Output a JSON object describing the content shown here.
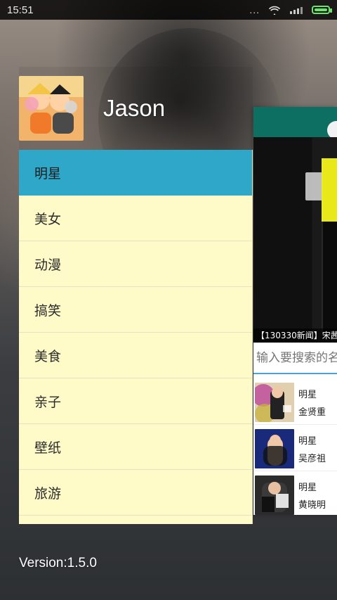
{
  "status_bar": {
    "time": "15:51",
    "dots": "...",
    "icons": [
      "wifi-icon",
      "signal-icon",
      "battery-icon"
    ],
    "battery_color": "#6fe36f"
  },
  "drawer": {
    "username": "Jason",
    "avatar_icon": "avatar-image",
    "menu": [
      {
        "label": "明星",
        "active": true
      },
      {
        "label": "美女",
        "active": false
      },
      {
        "label": "动漫",
        "active": false
      },
      {
        "label": "搞笑",
        "active": false
      },
      {
        "label": "美食",
        "active": false
      },
      {
        "label": "亲子",
        "active": false
      },
      {
        "label": "壁纸",
        "active": false
      },
      {
        "label": "旅游",
        "active": false
      }
    ],
    "version": "Version:1.5.0",
    "colors": {
      "active_bg": "#2ea7c9",
      "menu_bg": "#fffbc9"
    }
  },
  "content": {
    "topbar_color": "#0d6f61",
    "banner_caption": "【130330新闻】宋茜",
    "search": {
      "placeholder": "输入要搜索的名"
    },
    "items": [
      {
        "category": "明星",
        "name": "金贤重"
      },
      {
        "category": "明星",
        "name": "吴彦祖"
      },
      {
        "category": "明星",
        "name": "黄晓明"
      }
    ]
  }
}
